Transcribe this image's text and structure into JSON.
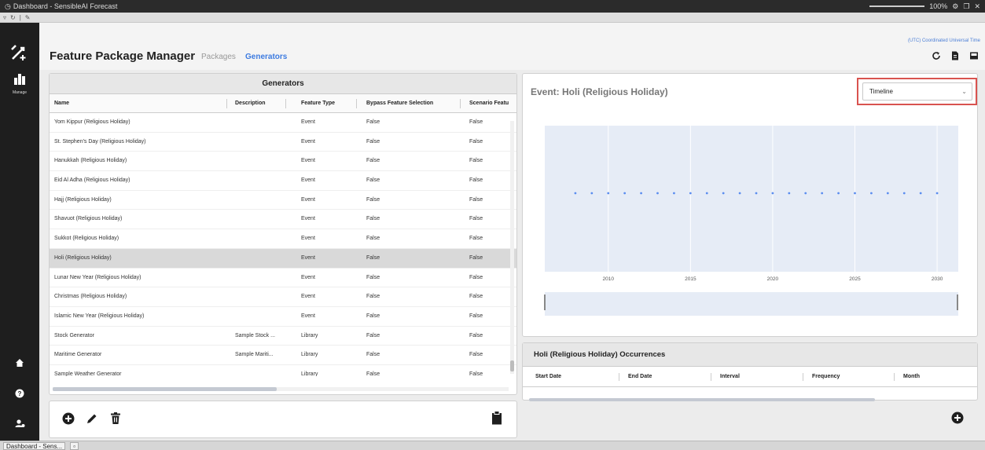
{
  "window": {
    "title": "Dashboard - SensibleAI Forecast",
    "zoom": "100%",
    "taskbar_item": "Dashboard - Sens..."
  },
  "nav": {
    "manage_label": "Manage"
  },
  "header": {
    "title": "Feature Package Manager",
    "tabs": [
      "Packages",
      "Generators"
    ],
    "active_tab": "Generators",
    "timezone": "(UTC) Coordinated Universal Time"
  },
  "generators": {
    "title": "Generators",
    "columns": [
      "Name",
      "Description",
      "Feature Type",
      "Bypass Feature Selection",
      "Scenario Featu"
    ],
    "rows": [
      [
        "Yom Kippur (Religious Holiday)",
        "",
        "Event",
        "False",
        "False"
      ],
      [
        "St. Stephen's Day (Religious Holiday)",
        "",
        "Event",
        "False",
        "False"
      ],
      [
        "Hanukkah (Religious Holiday)",
        "",
        "Event",
        "False",
        "False"
      ],
      [
        "Eid Al Adha (Religious Holiday)",
        "",
        "Event",
        "False",
        "False"
      ],
      [
        "Hajj (Religious Holiday)",
        "",
        "Event",
        "False",
        "False"
      ],
      [
        "Shavuot (Religious Holiday)",
        "",
        "Event",
        "False",
        "False"
      ],
      [
        "Sukkot (Religious Holiday)",
        "",
        "Event",
        "False",
        "False"
      ],
      [
        "Holi (Religious Holiday)",
        "",
        "Event",
        "False",
        "False"
      ],
      [
        "Lunar New Year (Religious Holiday)",
        "",
        "Event",
        "False",
        "False"
      ],
      [
        "Christmas (Religious Holiday)",
        "",
        "Event",
        "False",
        "False"
      ],
      [
        "Islamic New Year (Religious Holiday)",
        "",
        "Event",
        "False",
        "False"
      ],
      [
        "Stock Generator",
        "Sample Stock ...",
        "Library",
        "False",
        "False"
      ],
      [
        "Maritime Generator",
        "Sample Mariti...",
        "Library",
        "False",
        "False"
      ],
      [
        "Sample Weather Generator",
        "",
        "Library",
        "False",
        "False"
      ]
    ],
    "selected_row": "Holi (Religious Holiday)"
  },
  "event": {
    "title": "Event: Holi (Religious Holiday)",
    "view_select": "Timeline"
  },
  "chart_data": {
    "type": "scatter",
    "title": "",
    "xlabel": "",
    "ylabel": "",
    "x_ticks": [
      "2010",
      "2015",
      "2020",
      "2025",
      "2030"
    ],
    "xlim": [
      2007,
      2031
    ],
    "x": [
      2008,
      2009,
      2010,
      2011,
      2012,
      2013,
      2014,
      2015,
      2016,
      2017,
      2018,
      2019,
      2020,
      2021,
      2022,
      2023,
      2024,
      2025,
      2026,
      2027,
      2028,
      2029,
      2030
    ],
    "y": [
      1,
      1,
      1,
      1,
      1,
      1,
      1,
      1,
      1,
      1,
      1,
      1,
      1,
      1,
      1,
      1,
      1,
      1,
      1,
      1,
      1,
      1,
      1
    ],
    "color": "#5b8def",
    "background": "#e6ecf6",
    "grid": true
  },
  "occurrences": {
    "title": "Holi (Religious Holiday) Occurrences",
    "columns": [
      "Start Date",
      "End Date",
      "Interval",
      "Frequency",
      "Month"
    ]
  }
}
